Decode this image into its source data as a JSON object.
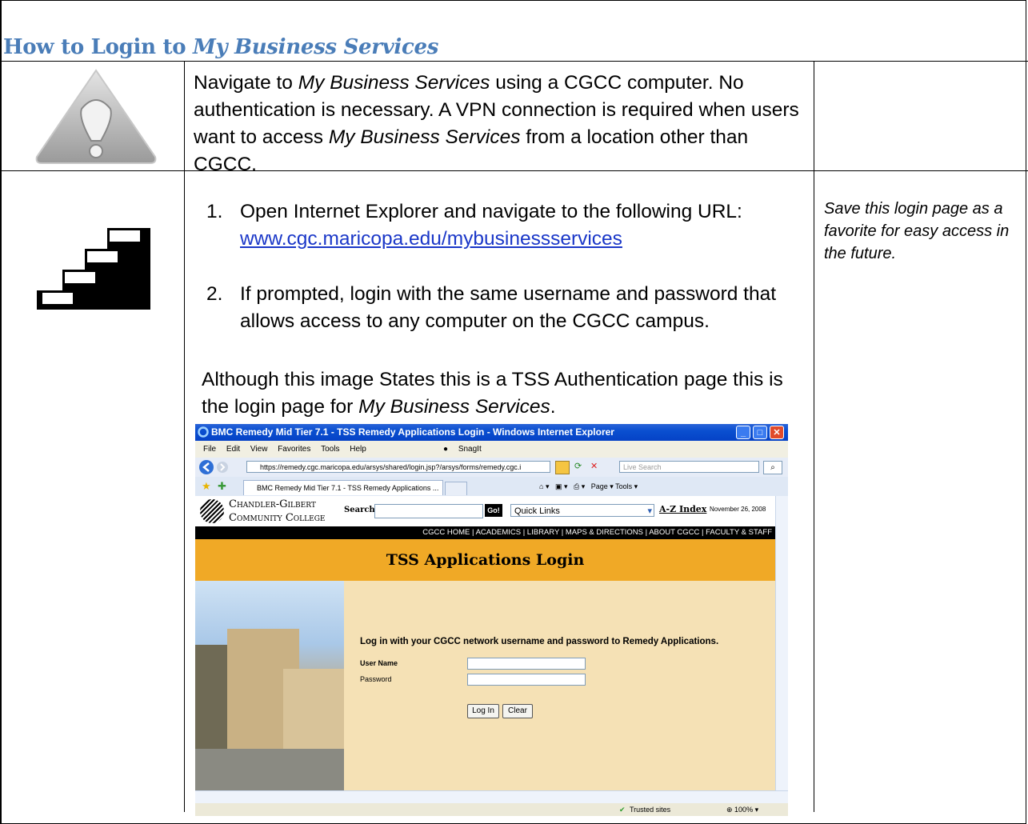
{
  "heading": {
    "prefix": "How to Login to ",
    "italic": "My Business Services"
  },
  "row1": {
    "paragraph": [
      {
        "t": "Navigate to "
      },
      {
        "i": "My Business Services"
      },
      {
        "t": " using a CGCC computer.  No authentication is necessary.   A VPN connection is required when users want to access "
      },
      {
        "i": "My Business Services"
      },
      {
        "t": " from a location other than CGCC."
      }
    ]
  },
  "row2": {
    "step1_num": "1.",
    "step1_text": "Open Internet Explorer and navigate to the following URL:",
    "step1_link": "www.cgc.maricopa.edu/mybusinessservices",
    "step2_num": "2.",
    "step2_text": "If prompted, login with the same username and password that allows access to any computer on the CGCC campus.",
    "note_prefix": "Although this image States this is a TSS Authentication page this is the login page for ",
    "note_italic": "My Business Services",
    "note_suffix": ".",
    "side_note": "Save this login page as a favorite for easy access in the future."
  },
  "browser": {
    "title": "BMC Remedy Mid Tier 7.1 - TSS Remedy Applications Login - Windows Internet Explorer",
    "menu": [
      "File",
      "Edit",
      "View",
      "Favorites",
      "Tools",
      "Help"
    ],
    "snagit": "SnagIt",
    "url": "https://remedy.cgc.maricopa.edu/arsys/shared/login.jsp?/arsys/forms/remedy.cgc.i",
    "search_placeholder": "Live Search",
    "tab_label": "BMC Remedy Mid Tier 7.1 - TSS Remedy Applications ...",
    "tools_strip": "Page ▾  Tools ▾",
    "college_line1": "Chandler-Gilbert",
    "college_line2": "Community College",
    "search_label": "Search:",
    "go_label": "Go!",
    "quick_links": "Quick Links",
    "az_index": "A-Z Index",
    "date": "November 26, 2008",
    "nav": "CGCC HOME | ACADEMICS | LIBRARY | MAPS & DIRECTIONS | ABOUT CGCC | FACULTY & STAFF",
    "banner": "TSS Applications Login",
    "login_msg": "Log in with your CGCC network username and password to Remedy Applications.",
    "user_label": "User Name",
    "password_label": "Password",
    "login_btn": "Log In",
    "clear_btn": "Clear",
    "trusted": "Trusted sites",
    "zoom": "100%"
  }
}
